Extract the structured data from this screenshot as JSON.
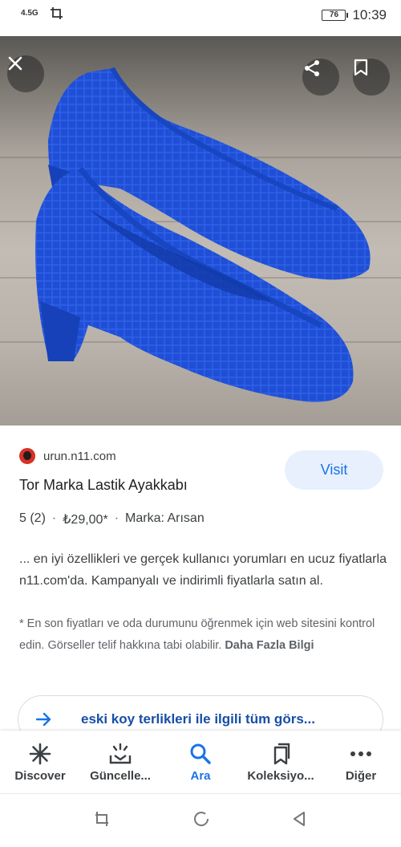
{
  "status_bar": {
    "network": "4.5G",
    "battery": "76",
    "time": "10:39"
  },
  "hero": {
    "colors": {
      "shoe": "#1d4ed8",
      "floor": "#bdb5ad"
    }
  },
  "result": {
    "source_domain": "urun.n11.com",
    "visit_label": "Visit",
    "title": "Tor Marka Lastik Ayakkabı",
    "rating": "5 (2)",
    "price": "₺29,00*",
    "brand": "Marka: Arısan",
    "description": "... en iyi özellikleri ve gerçek kullanıcı yorumları en ucuz fiyatlarla n11.com'da. Kampanyalı ve indirimli fiyatlarla satın al.",
    "note": "* En son fiyatları ve oda durumunu öğrenmek için web sitesini kontrol edin. Görseller telif hakkına tabi olabilir.",
    "note_link": "Daha Fazla Bilgi"
  },
  "related": {
    "text": "eski koy terlikleri ile ilgili tüm görs..."
  },
  "bottom_nav": {
    "items": [
      {
        "label": "Discover",
        "icon": "asterisk-icon"
      },
      {
        "label": "Güncelle...",
        "icon": "updates-icon"
      },
      {
        "label": "Ara",
        "icon": "search-icon",
        "active": true
      },
      {
        "label": "Koleksiyo...",
        "icon": "bookmarks-icon"
      },
      {
        "label": "Diğer",
        "icon": "more-icon"
      }
    ]
  },
  "colors": {
    "accent": "#1a73e8",
    "visit_bg": "#e8f0fe"
  }
}
